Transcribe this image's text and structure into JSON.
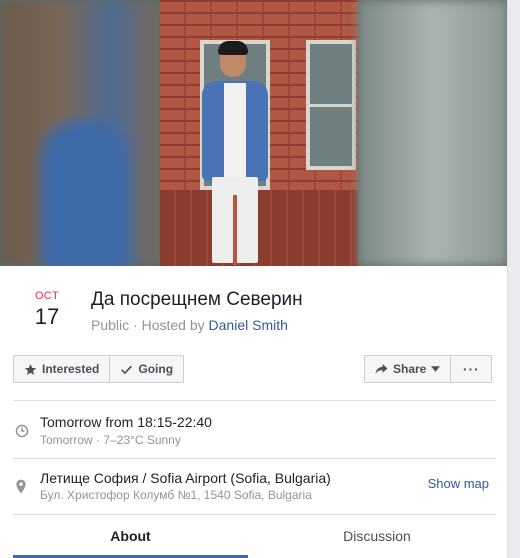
{
  "event": {
    "month": "OCT",
    "day": "17",
    "title": "Да посрещнем Северин",
    "privacy": "Public",
    "hosted_by_prefix": "Hosted by",
    "host": "Daniel Smith"
  },
  "actions": {
    "interested_label": "Interested",
    "going_label": "Going",
    "share_label": "Share",
    "more_label": "···"
  },
  "time": {
    "main": "Tomorrow from 18:15-22:40",
    "weather": "Tomorrow · 7–23°C Sunny"
  },
  "location": {
    "name": "Летище София / Sofia Airport (Sofia, Bulgaria)",
    "address": "Бул. Христофор Колумб №1, 1540 Sofia, Bulgaria",
    "show_map_label": "Show map"
  },
  "tabs": [
    {
      "label": "About",
      "active": true
    },
    {
      "label": "Discussion",
      "active": false
    }
  ],
  "colors": {
    "month": "#f02849",
    "link": "#365899",
    "tab_underline": "#4267b2"
  },
  "icons": {
    "interested": "star-icon",
    "going": "check-icon",
    "share": "share-arrow-icon",
    "time": "clock-icon",
    "location": "map-pin-icon"
  }
}
